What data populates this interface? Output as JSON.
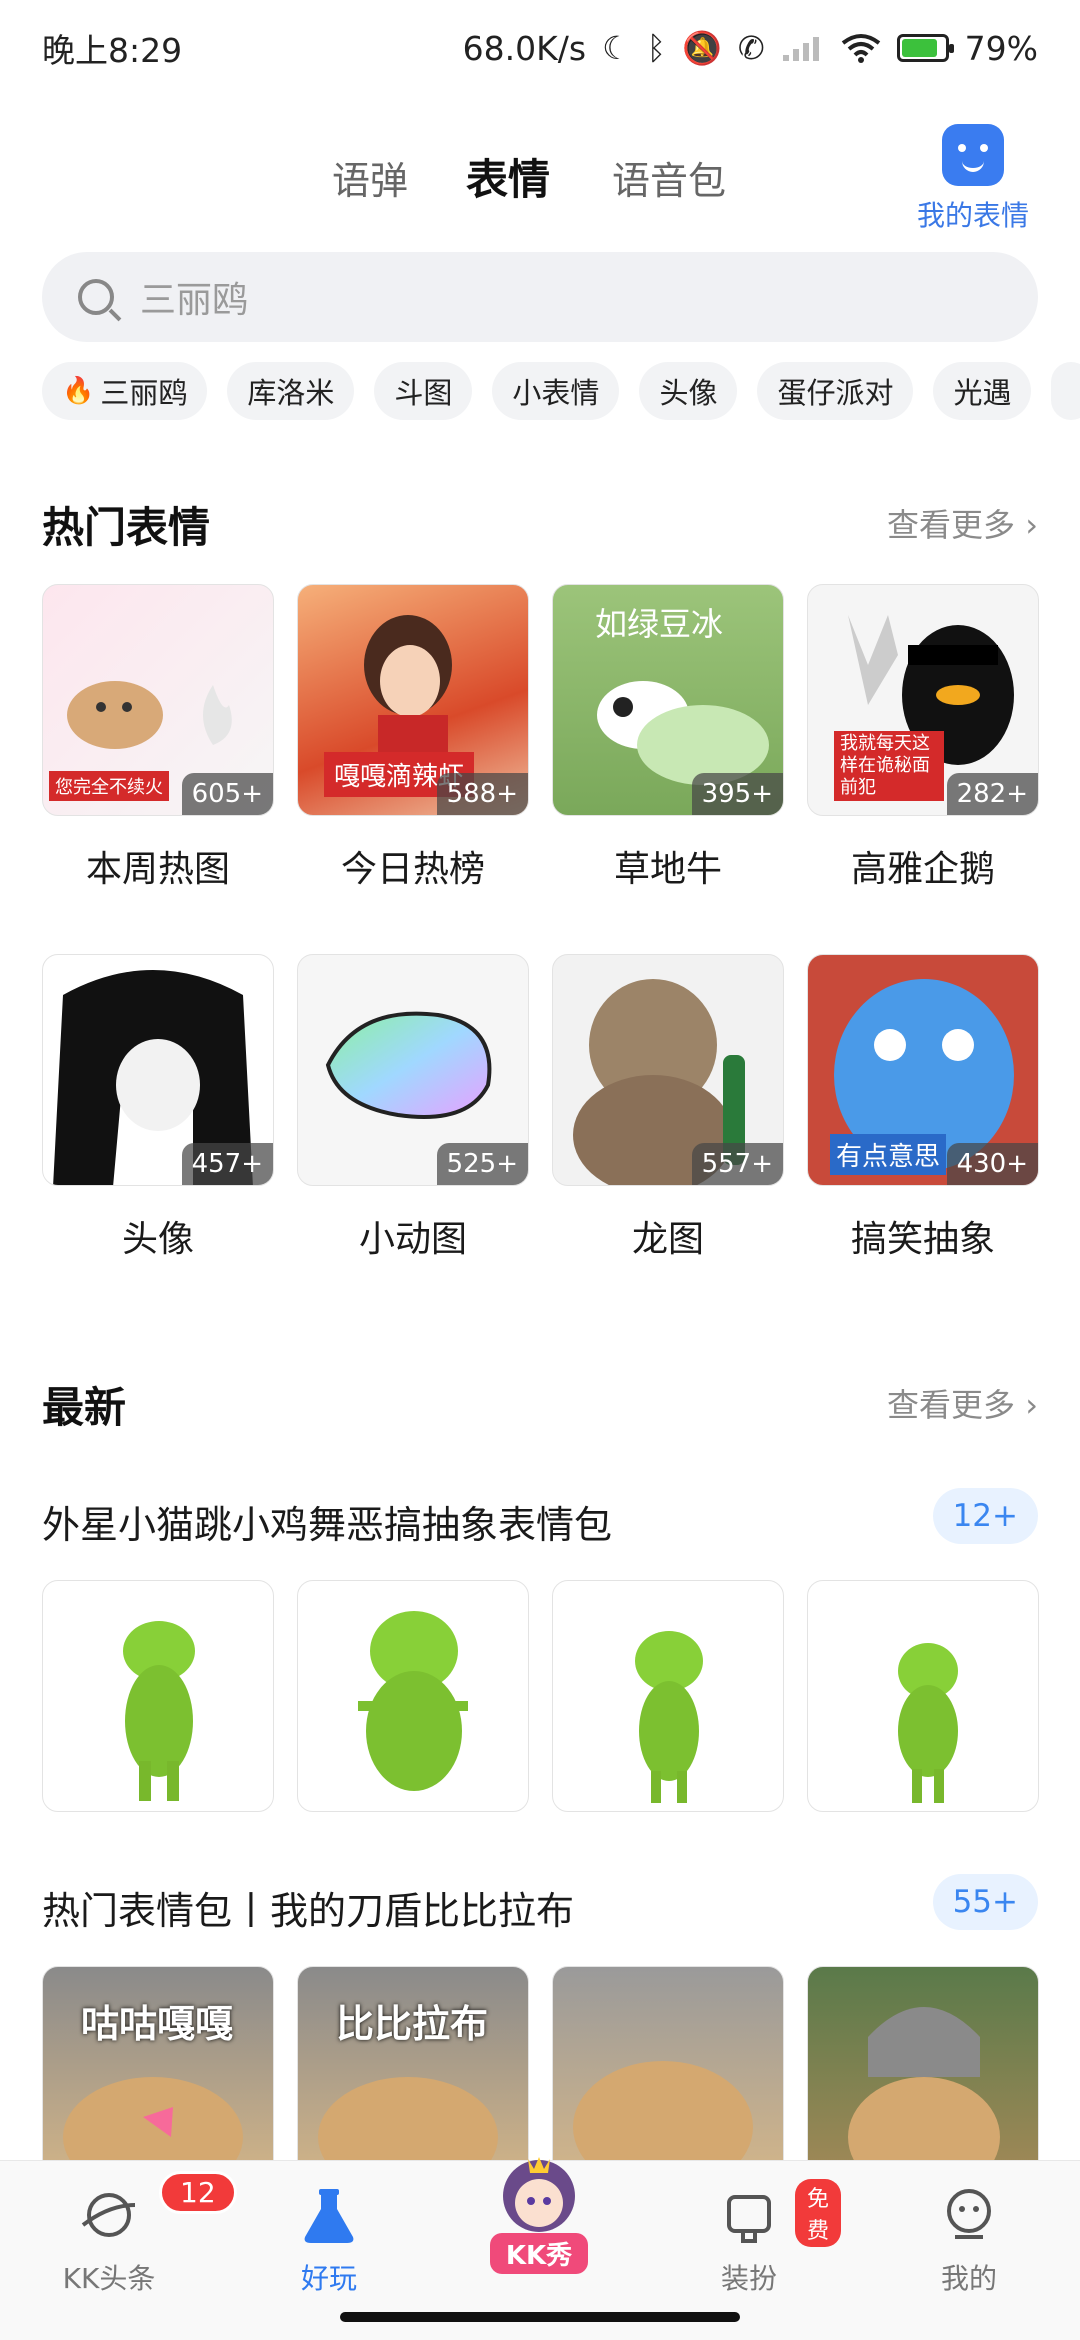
{
  "status_bar": {
    "time": "晚上8:29",
    "network_speed": "68.0K/s",
    "battery": "79%",
    "battery_level": 0.79,
    "icons": [
      "moon-icon",
      "bluetooth-icon",
      "mute-icon",
      "call-icon",
      "signal-icon",
      "wifi-icon",
      "battery-icon"
    ]
  },
  "top_tabs": {
    "tabs": [
      "语弹",
      "表情",
      "语音包"
    ],
    "active_index": 1,
    "my_emoji_label": "我的表情"
  },
  "search": {
    "placeholder": "三丽鸥"
  },
  "chips": [
    "三丽鸥",
    "库洛米",
    "斗图",
    "小表情",
    "头像",
    "蛋仔派对",
    "光遇"
  ],
  "hot": {
    "title": "热门表情",
    "more": "查看更多 ›",
    "items": [
      {
        "label": "本周热图",
        "count": "605+",
        "overlay": "您完全不续火"
      },
      {
        "label": "今日热榜",
        "count": "588+",
        "overlay": "嘎嘎滴辣虾"
      },
      {
        "label": "草地牛",
        "count": "395+",
        "overlay": "如绿豆冰"
      },
      {
        "label": "高雅企鹅",
        "count": "282+",
        "overlay": "我就每天这样在诡秘面前犯"
      },
      {
        "label": "头像",
        "count": "457+"
      },
      {
        "label": "小动图",
        "count": "525+"
      },
      {
        "label": "龙图",
        "count": "557+"
      },
      {
        "label": "搞笑抽象",
        "count": "430+",
        "overlay": "有点意思"
      }
    ]
  },
  "newest": {
    "title": "最新",
    "more": "查看更多 ›",
    "packs": [
      {
        "title": "外星小猫跳小鸡舞恶搞抽象表情包",
        "count": "12+"
      },
      {
        "title": "热门表情包丨我的刀盾比比拉布",
        "count": "55+",
        "captions": [
          "咕咕嘎嘎",
          "比比拉布"
        ]
      }
    ]
  },
  "bottom_nav": {
    "items": [
      {
        "label": "KK头条",
        "badge": "12"
      },
      {
        "label": "好玩"
      },
      {
        "label": "KK秀"
      },
      {
        "label": "装扮",
        "badge": "免费"
      },
      {
        "label": "我的"
      }
    ],
    "active_index": 1
  },
  "colors": {
    "accent": "#2f7af0",
    "tab_underline": "#ffd21f",
    "badge": "#f23a3a"
  }
}
